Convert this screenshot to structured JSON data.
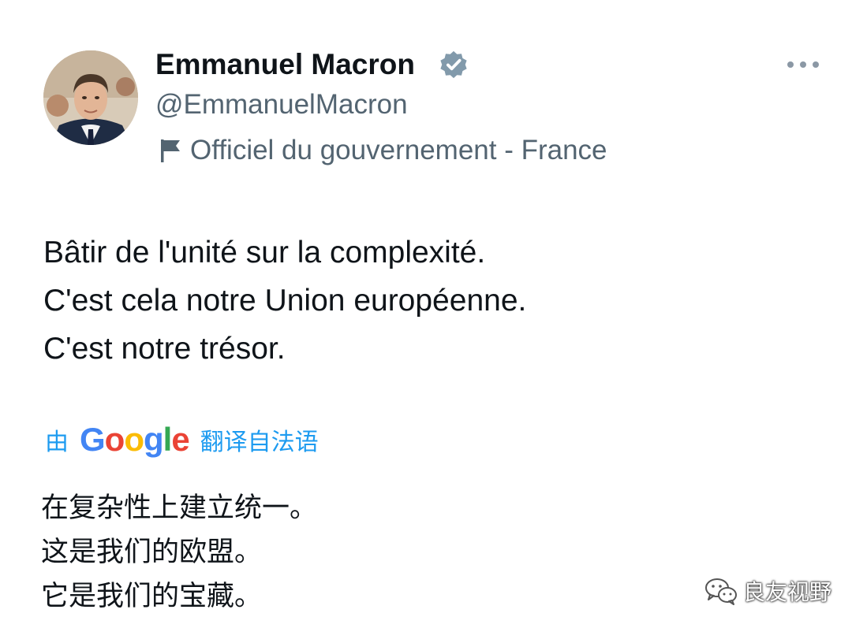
{
  "author": {
    "display_name": "Emmanuel Macron",
    "handle": "@EmmanuelMacron",
    "affiliation": "Officiel du gouvernement - France",
    "verified_icon": "verified-badge-icon",
    "affiliation_icon": "flag-icon",
    "avatar_icon": "profile-photo"
  },
  "menu": {
    "icon": "more-options-icon"
  },
  "tweet": {
    "lines": [
      "Bâtir de l'unité sur la complexité.",
      "C'est cela notre Union européenne.",
      "C'est notre trésor."
    ]
  },
  "translation": {
    "prefix": "由",
    "provider": "Google",
    "suffix": "翻译自法语",
    "lines": [
      "在复杂性上建立统一。",
      "这是我们的欧盟。",
      "它是我们的宝藏。"
    ]
  },
  "watermark": {
    "label": "良友视野",
    "icon": "wechat-icon"
  },
  "colors": {
    "accent": "#1d9bf0",
    "secondary_text": "#536471",
    "primary_text": "#0f1419",
    "verified_badge": "#829aab"
  }
}
